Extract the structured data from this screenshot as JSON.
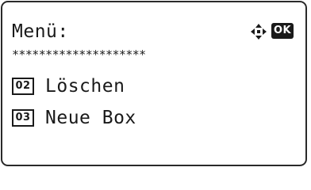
{
  "screen": {
    "title": "Menü:",
    "separator": "********************",
    "nav_icon": "four-way-arrow-icon",
    "ok_label": "OK"
  },
  "menu": {
    "items": [
      {
        "number": "02",
        "label": "Löschen"
      },
      {
        "number": "03",
        "label": "Neue Box"
      }
    ]
  }
}
